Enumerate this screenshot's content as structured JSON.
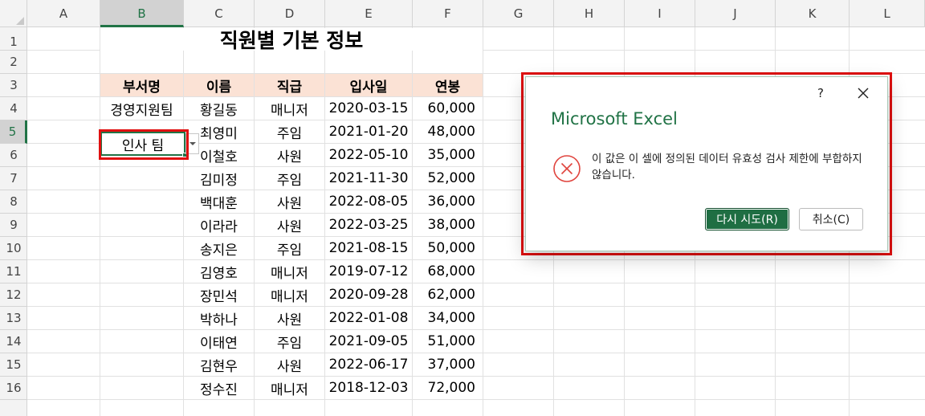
{
  "columns": [
    "A",
    "B",
    "C",
    "D",
    "E",
    "F",
    "G",
    "H",
    "I",
    "J",
    "K",
    "L"
  ],
  "rows": [
    "1",
    "2",
    "3",
    "4",
    "5",
    "6",
    "7",
    "8",
    "9",
    "10",
    "11",
    "12",
    "13",
    "14",
    "15",
    "16"
  ],
  "selected_column": "B",
  "selected_row": "5",
  "sheet": {
    "title": "직원별 기본 정보",
    "headers": [
      "부서명",
      "이름",
      "직급",
      "입사일",
      "연봉"
    ],
    "dept_row4": "경영지원팀",
    "active_cell_value": "인사 팀",
    "records": [
      {
        "name": "황길동",
        "position": "매니저",
        "hire_date": "2020-03-15",
        "salary": "60,000"
      },
      {
        "name": "최영미",
        "position": "주임",
        "hire_date": "2021-01-20",
        "salary": "48,000"
      },
      {
        "name": "이철호",
        "position": "사원",
        "hire_date": "2022-05-10",
        "salary": "35,000"
      },
      {
        "name": "김미정",
        "position": "주임",
        "hire_date": "2021-11-30",
        "salary": "52,000"
      },
      {
        "name": "백대훈",
        "position": "사원",
        "hire_date": "2022-08-05",
        "salary": "36,000"
      },
      {
        "name": "이라라",
        "position": "사원",
        "hire_date": "2022-03-25",
        "salary": "38,000"
      },
      {
        "name": "송지은",
        "position": "주임",
        "hire_date": "2021-08-15",
        "salary": "50,000"
      },
      {
        "name": "김영호",
        "position": "매니저",
        "hire_date": "2019-07-12",
        "salary": "68,000"
      },
      {
        "name": "장민석",
        "position": "매니저",
        "hire_date": "2020-09-28",
        "salary": "62,000"
      },
      {
        "name": "박하나",
        "position": "사원",
        "hire_date": "2022-01-08",
        "salary": "34,000"
      },
      {
        "name": "이태연",
        "position": "주임",
        "hire_date": "2021-09-05",
        "salary": "51,000"
      },
      {
        "name": "김현우",
        "position": "사원",
        "hire_date": "2022-06-17",
        "salary": "37,000"
      },
      {
        "name": "정수진",
        "position": "매니저",
        "hire_date": "2018-12-03",
        "salary": "72,000"
      }
    ]
  },
  "dialog": {
    "help": "?",
    "title": "Microsoft Excel",
    "message": "이 값은 이 셀에 정의된 데이터 유효성 검사 제한에 부합하지 않습니다.",
    "retry_label": "다시 시도(R)",
    "cancel_label": "취소(C)",
    "icon": "error-circle-x-icon"
  },
  "colors": {
    "excel_green": "#217346",
    "header_fill": "#fbe2d5",
    "highlight_red": "#e01010"
  }
}
